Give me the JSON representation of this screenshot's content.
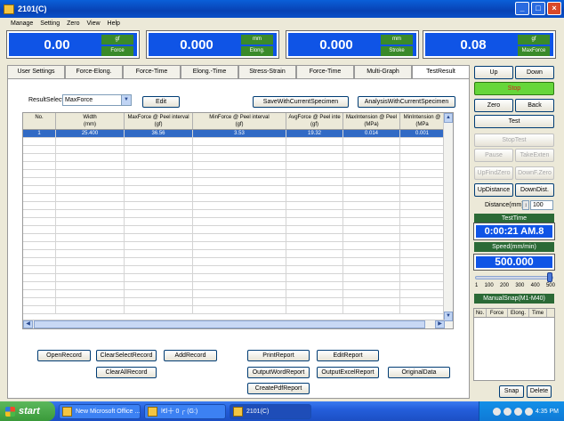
{
  "window": {
    "title": "2101(C)",
    "controls": [
      "_",
      "□",
      "×"
    ]
  },
  "menu": [
    "Manage",
    "Setting",
    "Zero",
    "View",
    "Help"
  ],
  "readouts": [
    {
      "value": "0.00",
      "unit": "gf",
      "label": "Force"
    },
    {
      "value": "0.000",
      "unit": "mm",
      "label": "Elong."
    },
    {
      "value": "0.000",
      "unit": "mm",
      "label": "Stroke"
    },
    {
      "value": "0.08",
      "unit": "gf",
      "label": "MaxForce"
    }
  ],
  "tabs": [
    "User Settings",
    "Force-Elong.",
    "Force-Time",
    "Elong.-Time",
    "Stress-Strain",
    "Force-Time",
    "Multi-Graph",
    "TestResult"
  ],
  "active_tab": "TestResult",
  "result": {
    "select_label": "ResultSelect",
    "select_value": "MaxForce",
    "edit_label": "Edit",
    "save_label": "SaveWithCurrentSpecimen",
    "analysis_label": "AnalysisWithCurrentSpecimen"
  },
  "table": {
    "headers": [
      [
        "No.",
        ""
      ],
      [
        "Width",
        "(mm)"
      ],
      [
        "MaxForce @ Peel interval",
        "(gf)"
      ],
      [
        "MinForce @ Peel interval",
        "(gf)"
      ],
      [
        "AvgForce @ Peel inte",
        "(gf)"
      ],
      [
        "MaxIntension @ Peel",
        "(MPa)"
      ],
      [
        "MinIntension @",
        "(MPa"
      ]
    ],
    "rows": [
      [
        "1",
        "25.400",
        "36.56",
        "3.53",
        "19.32",
        "0.014",
        "0.001"
      ]
    ]
  },
  "bottom_buttons": {
    "open": "OpenRecord",
    "clear_select": "ClearSelectRecord",
    "add": "AddRecord",
    "print": "PrintReport",
    "edit_report": "EditReport",
    "clear_all": "ClearAllRecord",
    "word": "OutputWordReport",
    "excel": "OutputExcelReport",
    "original": "OriginalData",
    "pdf": "CreatePdfReport"
  },
  "right": {
    "up": "Up",
    "down": "Down",
    "stop": "Stop",
    "zero": "Zero",
    "back": "Back",
    "test": "Test",
    "stop_test": "StopTest",
    "pause": "Pause",
    "take_exten": "TakeExten",
    "up_find_zero": "UpFindZero",
    "down_f_zero": "DownF.Zero",
    "up_distance": "UpDistance",
    "down_dist": "DownDist.",
    "distance_label": "Distance(mm)",
    "distance_value": "100",
    "test_time_label": "TestTime",
    "test_time": "0:00:21 AM.8",
    "speed_label": "Speed(mm/min)",
    "speed": "500.000",
    "speed_fraction": 0.99,
    "slider_ticks": [
      "1",
      "100",
      "200",
      "300",
      "400",
      "500"
    ],
    "manual_snap_label": "ManualSnap(M1-M40)",
    "snap_headers": [
      "No.",
      "Force",
      "Elong.",
      "Time"
    ],
    "snap": "Snap",
    "delete": "Delete"
  },
  "taskbar": {
    "start": "start",
    "tasks": [
      "New Microsoft Office ...",
      "ǀ€ǀ十 0 ┌ (G:)",
      "2101(C)"
    ],
    "clock": "4:35 PM"
  }
}
